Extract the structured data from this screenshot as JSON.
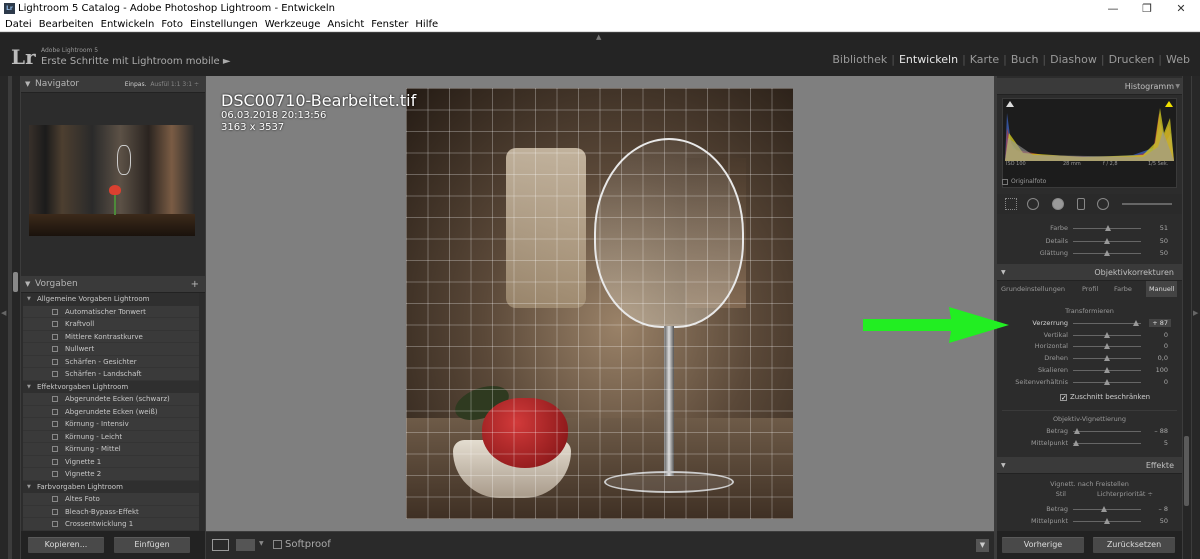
{
  "window": {
    "title": "Lightroom 5 Catalog - Adobe Photoshop Lightroom - Entwickeln",
    "app_icon": "Lr",
    "controls": [
      "—",
      "❐",
      "✕"
    ]
  },
  "menu": [
    "Datei",
    "Bearbeiten",
    "Entwickeln",
    "Foto",
    "Einstellungen",
    "Werkzeuge",
    "Ansicht",
    "Fenster",
    "Hilfe"
  ],
  "identity": {
    "logo": "Lr",
    "small": "Adobe Lightroom 5",
    "catalog": "Erste Schritte mit Lightroom mobile ►"
  },
  "modules": [
    {
      "label": "Bibliothek",
      "active": false
    },
    {
      "label": "Entwickeln",
      "active": true
    },
    {
      "label": "Karte",
      "active": false
    },
    {
      "label": "Buch",
      "active": false
    },
    {
      "label": "Diashow",
      "active": false
    },
    {
      "label": "Drucken",
      "active": false
    },
    {
      "label": "Web",
      "active": false
    }
  ],
  "navigator": {
    "title": "Navigator",
    "opt_active": "Einpas.",
    "opt_rest": "Ausfül  1:1  3:1 ÷"
  },
  "presets": {
    "title": "Vorgaben",
    "add": "+",
    "groups": [
      {
        "name": "Allgemeine Vorgaben Lightroom",
        "items": [
          "Automatischer Tonwert",
          "Kraftvoll",
          "Mittlere Kontrastkurve",
          "Nullwert",
          "Schärfen - Gesichter",
          "Schärfen - Landschaft"
        ]
      },
      {
        "name": "Effektvorgaben Lightroom",
        "items": [
          "Abgerundete Ecken (schwarz)",
          "Abgerundete Ecken (weiß)",
          "Körnung - Intensiv",
          "Körnung - Leicht",
          "Körnung - Mittel",
          "Vignette 1",
          "Vignette 2"
        ]
      },
      {
        "name": "Farbvorgaben Lightroom",
        "items": [
          "Altes Foto",
          "Bleach-Bypass-Effekt",
          "Crossentwicklung 1"
        ]
      }
    ]
  },
  "left_buttons": {
    "copy": "Kopieren...",
    "paste": "Einfügen"
  },
  "photo_info": {
    "filename": "DSC00710-Bearbeitet.tif",
    "datetime": "06.03.2018 20:13:56",
    "dimensions": "3163 x 3537"
  },
  "toolbar": {
    "softproof": "Softproof"
  },
  "histogram": {
    "title": "Histogramm",
    "iso": "ISO 100",
    "focal": "28 mm",
    "aperture": "f / 2,8",
    "shutter": "1/5 Sek.",
    "original": "Originalfoto"
  },
  "noise": [
    {
      "label": "Farbe",
      "value": "51",
      "pct": 0.51
    },
    {
      "label": "Details",
      "value": "50",
      "pct": 0.5
    },
    {
      "label": "Glättung",
      "value": "50",
      "pct": 0.5
    }
  ],
  "lens": {
    "title": "Objektivkorrekturen",
    "tabs": [
      "Grundeinstellungen",
      "Profil",
      "Farbe",
      "Manuell"
    ],
    "active_tab": "Manuell",
    "transform_title": "Transformieren",
    "transform": [
      {
        "label": "Verzerrung",
        "value": "+ 87",
        "pct": 0.93,
        "highlight": true
      },
      {
        "label": "Vertikal",
        "value": "0",
        "pct": 0.5
      },
      {
        "label": "Horizontal",
        "value": "0",
        "pct": 0.5
      },
      {
        "label": "Drehen",
        "value": "0,0",
        "pct": 0.5
      },
      {
        "label": "Skalieren",
        "value": "100",
        "pct": 0.5
      },
      {
        "label": "Seitenverhältnis",
        "value": "0",
        "pct": 0.5
      }
    ],
    "crop_label": "Zuschnitt beschränken",
    "crop_checked": true,
    "vignette_title": "Objektiv-Vignettierung",
    "vignette": [
      {
        "label": "Betrag",
        "value": "– 88",
        "pct": 0.06
      },
      {
        "label": "Mittelpunkt",
        "value": "5",
        "pct": 0.05
      }
    ]
  },
  "effects": {
    "title": "Effekte",
    "vignette_title": "Vignett. nach Freistellen",
    "style_label": "Stil",
    "style_value": "Lichterpriorität ÷",
    "sliders": [
      {
        "label": "Betrag",
        "value": "– 8",
        "pct": 0.46
      },
      {
        "label": "Mittelpunkt",
        "value": "50",
        "pct": 0.5
      }
    ]
  },
  "right_buttons": {
    "prev": "Vorherige",
    "reset": "Zurücksetzen"
  },
  "colors": {
    "accent_arrow": "#22ee22",
    "panel": "#2c2c2c",
    "canvas": "#7f7f7f"
  }
}
